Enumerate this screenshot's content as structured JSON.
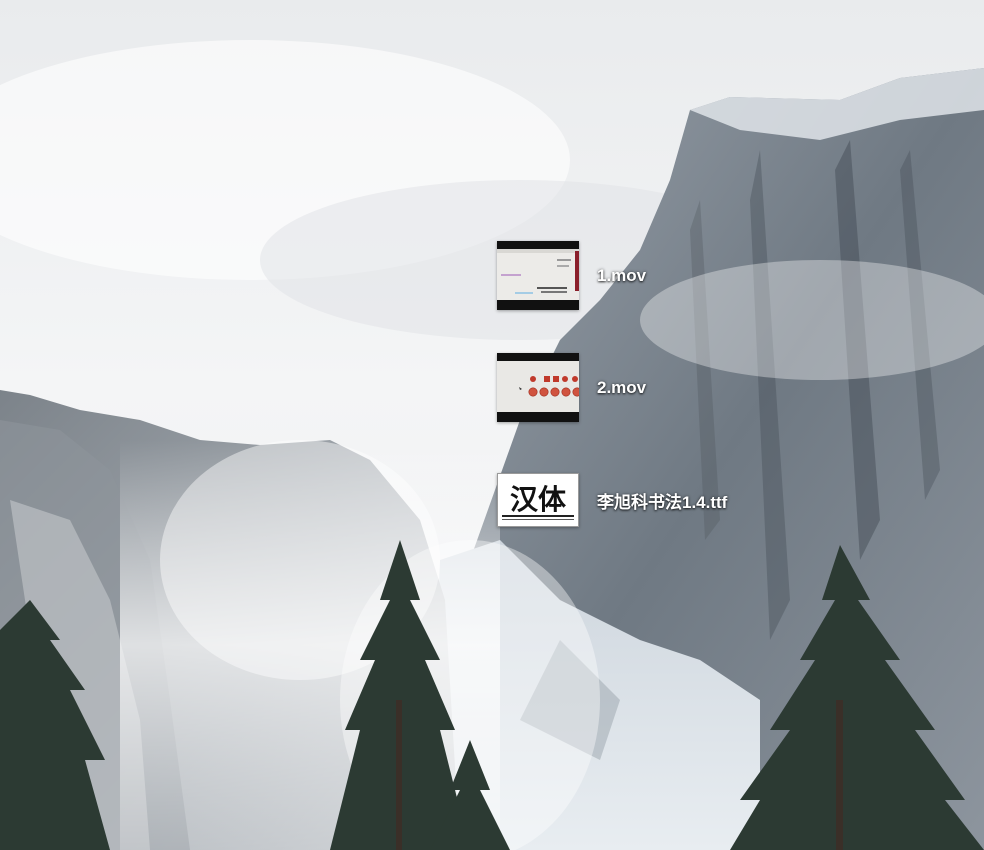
{
  "desktop": {
    "wallpaper": "yosemite-snowy-cliff",
    "items": [
      {
        "name": "1.mov",
        "kind": "video",
        "icon": "video-thumbnail-icon"
      },
      {
        "name": "2.mov",
        "kind": "video",
        "icon": "video-thumbnail-icon"
      },
      {
        "name": "李旭科书法1.4.ttf",
        "kind": "font",
        "icon": "font-preview-icon",
        "preview_text": "汉体"
      }
    ]
  },
  "colors": {
    "sky": "#f1f2f3",
    "rock": "#7f8892",
    "snow": "#e4e9ee",
    "tree": "#2b3a33",
    "label": "#ffffff"
  }
}
